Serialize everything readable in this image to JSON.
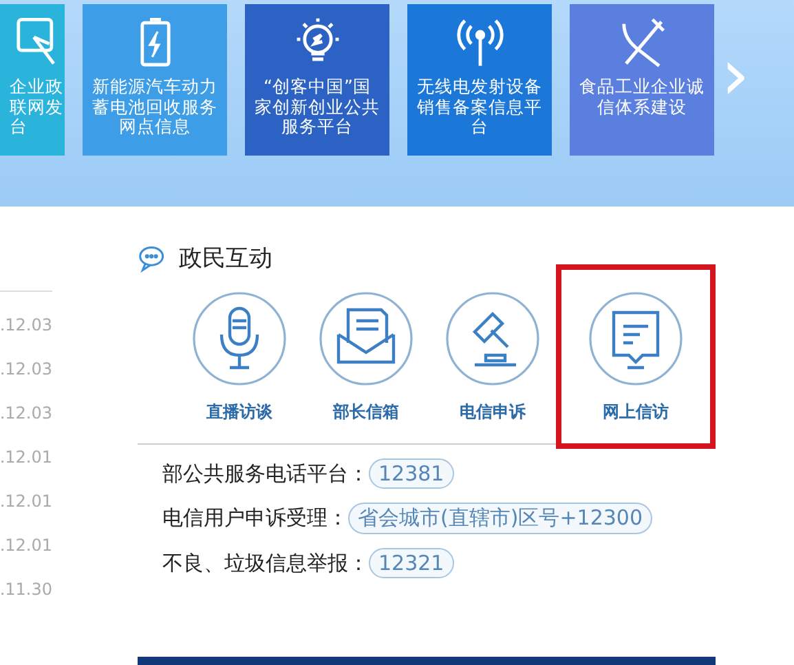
{
  "banner": {
    "tiles": [
      {
        "kind": "cursor",
        "color": "#2ab4dc",
        "lines": [
          "企业政",
          "联网发",
          "台"
        ],
        "cut": true
      },
      {
        "kind": "battery",
        "color": "#3d9de6",
        "lines": [
          "新能源汽车动力",
          "蓄电池回收服务",
          "网点信息"
        ],
        "cut": false
      },
      {
        "kind": "bulb",
        "color": "#2b62c4",
        "lines": [
          "“创客中国”国",
          "家创新创业公共",
          "服务平台"
        ],
        "cut": false
      },
      {
        "kind": "antenna",
        "color": "#1b78d8",
        "lines": [
          "无线电发射设备",
          "销售备案信息平",
          "台"
        ],
        "cut": false
      },
      {
        "kind": "utensils",
        "color": "#5b7fdf",
        "lines": [
          "食品工业企业诚",
          "信体系建设"
        ],
        "cut": false
      }
    ],
    "next": "›"
  },
  "news_dates": [
    ".12.03",
    ".12.03",
    ".12.03",
    ".12.01",
    ".12.01",
    ".12.01",
    ".11.30"
  ],
  "interaction": {
    "title": "政民互动",
    "items": [
      {
        "kind": "mic",
        "label": "直播访谈",
        "highlighted": false
      },
      {
        "kind": "mail",
        "label": "部长信箱",
        "highlighted": false
      },
      {
        "kind": "gavel",
        "label": "电信申诉",
        "highlighted": false
      },
      {
        "kind": "screen",
        "label": "网上信访",
        "highlighted": true
      }
    ],
    "hotlines": [
      {
        "label": "部公共服务电话平台：",
        "number": "12381"
      },
      {
        "label": "电信用户申诉受理：",
        "number": "省会城市(直辖市)区号+12300"
      },
      {
        "label": "不良、垃圾信息举报：",
        "number": "12321"
      }
    ]
  }
}
